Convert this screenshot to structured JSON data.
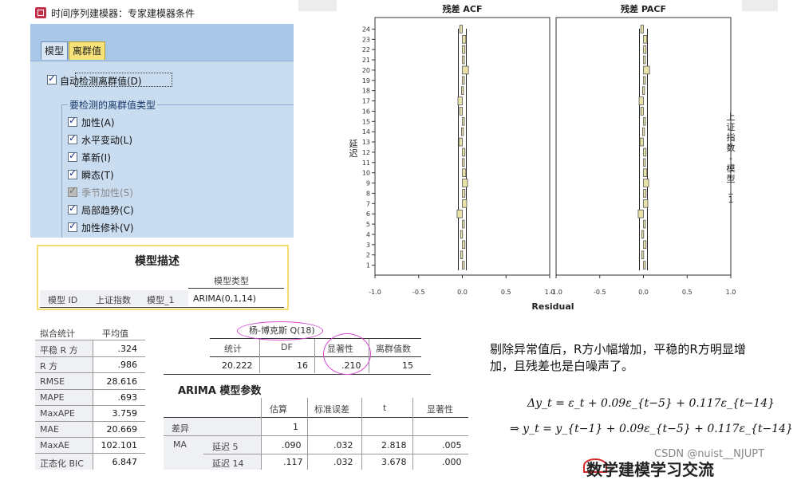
{
  "dialog": {
    "title": "时间序列建模器：专家建模器条件",
    "tabs": [
      "模型",
      "离群值"
    ],
    "auto_detect_label": "自动检测离群值(D)",
    "group_label": "要检测的离群值类型",
    "options": [
      {
        "label": "加性(A)",
        "checked": true,
        "enabled": true
      },
      {
        "label": "水平变动(L)",
        "checked": true,
        "enabled": true
      },
      {
        "label": "革新(I)",
        "checked": true,
        "enabled": true
      },
      {
        "label": "瞬态(T)",
        "checked": true,
        "enabled": true
      },
      {
        "label": "季节加性(S)",
        "checked": true,
        "enabled": false
      },
      {
        "label": "局部趋势(C)",
        "checked": true,
        "enabled": true
      },
      {
        "label": "加性修补(V)",
        "checked": true,
        "enabled": true
      }
    ]
  },
  "model_description": {
    "title": "模型描述",
    "header": "模型类型",
    "row": [
      "模型 ID",
      "上证指数",
      "模型_1",
      "ARIMA(0,1,14)"
    ]
  },
  "fit_stats": {
    "header": [
      "拟合统计",
      "平均值"
    ],
    "rows": [
      [
        "平稳 R 方",
        ".324"
      ],
      [
        "R 方",
        ".986"
      ],
      [
        "RMSE",
        "28.616"
      ],
      [
        "MAPE",
        ".693"
      ],
      [
        "MaxAPE",
        "3.759"
      ],
      [
        "MAE",
        "20.669"
      ],
      [
        "MaxAE",
        "102.101"
      ],
      [
        "正态化 BIC",
        "6.847"
      ]
    ]
  },
  "ljung_box": {
    "title": "杨-博克斯 Q(18)",
    "headers": [
      "统计",
      "DF",
      "显著性",
      "离群值数"
    ],
    "values": [
      "20.222",
      "16",
      ".210",
      "15"
    ]
  },
  "arima": {
    "title": "ARIMA 模型参数",
    "headers": [
      "估算",
      "标准误差",
      "t",
      "显著性"
    ],
    "rows": [
      {
        "label1": "差异",
        "label2": "",
        "values": [
          "1",
          "",
          "",
          ""
        ]
      },
      {
        "label1": "MA",
        "label2": "延迟 5",
        "values": [
          ".090",
          ".032",
          "2.818",
          ".005"
        ]
      },
      {
        "label1": "",
        "label2": "延迟 14",
        "values": [
          ".117",
          ".032",
          "3.678",
          ".000"
        ]
      }
    ]
  },
  "note": "剔除异常值后，R方小幅增加，平稳的R方明显增加，且残差也是白噪声了。",
  "formulas": [
    "Δy_t = ε_t + 0.09ε_{t−5} + 0.117ε_{t−14}",
    "⇒ y_t = y_{t−1} + 0.09ε_{t−5} + 0.117ε_{t−14}"
  ],
  "watermark": "CSDN @nuist__NJUPT",
  "logo_text": "数学建模学习交流",
  "chart_data": [
    {
      "type": "bar",
      "title": "残差 ACF",
      "xlabel": "Residual",
      "ylabel": "延迟",
      "lags": [
        1,
        2,
        3,
        4,
        5,
        6,
        7,
        8,
        9,
        10,
        11,
        12,
        13,
        14,
        15,
        16,
        17,
        18,
        19,
        20,
        21,
        22,
        23,
        24
      ],
      "values": [
        0.02,
        -0.02,
        0.03,
        -0.02,
        0.01,
        -0.06,
        0.05,
        0.03,
        0.06,
        0.04,
        0.02,
        0.03,
        -0.04,
        -0.01,
        0.02,
        -0.03,
        -0.05,
        -0.01,
        0.01,
        0.07,
        0.01,
        0.03,
        0.04,
        -0.03
      ],
      "xticks": [
        "-1.0",
        "-0.5",
        "0.0",
        "0.5",
        "1.0"
      ],
      "xlim": [
        -1,
        1
      ]
    },
    {
      "type": "bar",
      "title": "残差 PACF",
      "xlabel": "Residual",
      "ylabel": "上证指数-模型_1",
      "lags": [
        1,
        2,
        3,
        4,
        5,
        6,
        7,
        8,
        9,
        10,
        11,
        12,
        13,
        14,
        15,
        16,
        17,
        18,
        19,
        20,
        21,
        22,
        23,
        24
      ],
      "values": [
        0.02,
        -0.02,
        0.03,
        -0.02,
        0.01,
        -0.06,
        0.05,
        0.03,
        0.06,
        0.04,
        0.02,
        0.03,
        -0.04,
        -0.01,
        0.02,
        -0.03,
        -0.05,
        -0.01,
        0.01,
        0.07,
        0.01,
        0.03,
        0.04,
        -0.03
      ],
      "xticks": [
        "-1.0",
        "-0.5",
        "0.0",
        "0.5",
        "1.0"
      ],
      "xlim": [
        -1,
        1
      ]
    }
  ],
  "colors": {
    "bar_fill": "#e8e2a8",
    "bar_stroke": "#555555",
    "dialog_bg": "#c9dcf0",
    "tab_active": "#f7e27a",
    "highlight": "#d24ad0"
  }
}
